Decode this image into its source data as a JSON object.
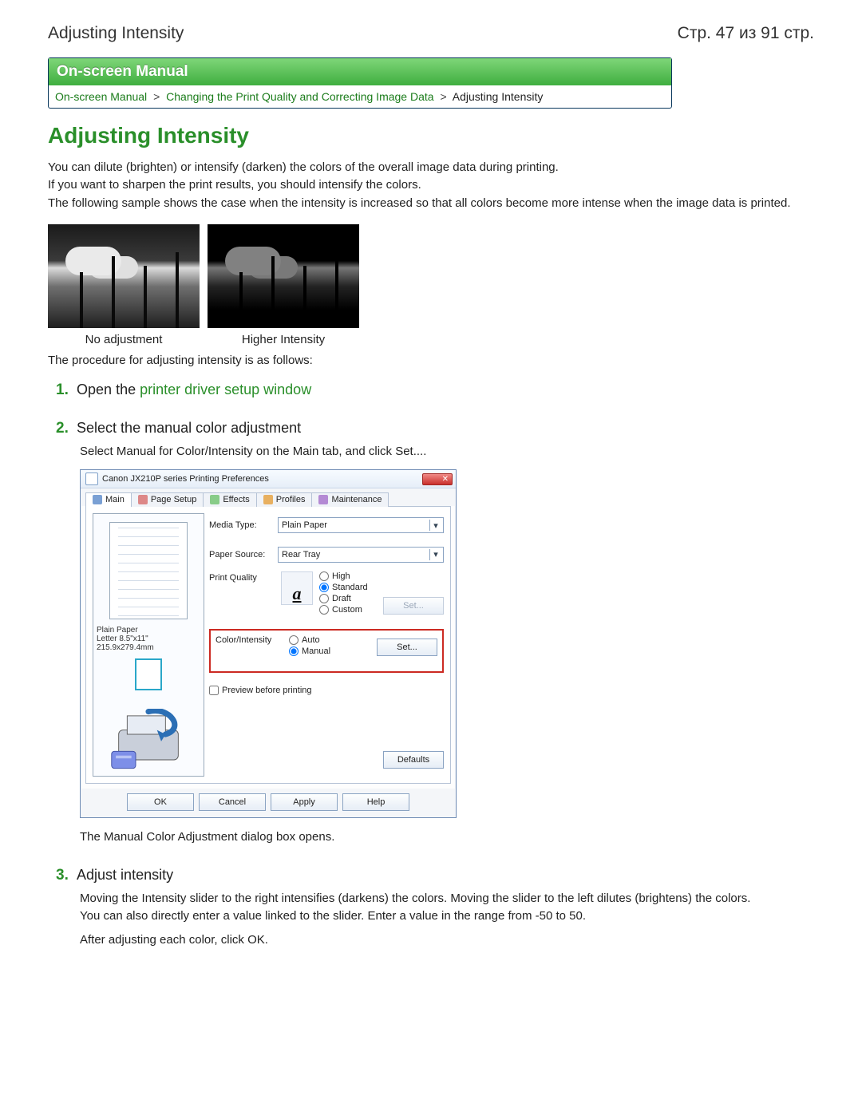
{
  "header": {
    "left": "Adjusting Intensity",
    "right": "Стр. 47 из 91 стр."
  },
  "banner": "On-screen Manual",
  "breadcrumb": {
    "a": "On-screen Manual",
    "b": "Changing the Print Quality and Correcting Image Data",
    "here": "Adjusting Intensity"
  },
  "title": "Adjusting Intensity",
  "intro": {
    "p1": "You can dilute (brighten) or intensify (darken) the colors of the overall image data during printing.",
    "p2": "If you want to sharpen the print results, you should intensify the colors.",
    "p3": "The following sample shows the case when the intensity is increased so that all colors become more intense when the image data is printed."
  },
  "samples": {
    "left": "No adjustment",
    "right": "Higher Intensity"
  },
  "procedure_line": "The procedure for adjusting intensity is as follows:",
  "steps": {
    "s1": {
      "pre": "Open the ",
      "link": "printer driver setup window"
    },
    "s2": {
      "title": "Select the manual color adjustment",
      "desc": "Select Manual for Color/Intensity on the Main tab, and click Set....",
      "after": "The Manual Color Adjustment dialog box opens."
    },
    "s3": {
      "title": "Adjust intensity",
      "p1": "Moving the Intensity slider to the right intensifies (darkens) the colors. Moving the slider to the left dilutes (brightens) the colors.",
      "p2": "You can also directly enter a value linked to the slider. Enter a value in the range from -50 to 50.",
      "p3": "After adjusting each color, click OK."
    }
  },
  "dialog": {
    "title": "Canon JX210P series Printing Preferences",
    "close_glyph": "✕",
    "tabs": {
      "main": "Main",
      "page": "Page Setup",
      "effects": "Effects",
      "profiles": "Profiles",
      "maint": "Maintenance"
    },
    "labels": {
      "media": "Media Type:",
      "source": "Paper Source:",
      "quality": "Print Quality",
      "color": "Color/Intensity",
      "preview_chk": "Preview before printing"
    },
    "values": {
      "media": "Plain Paper",
      "source": "Rear Tray"
    },
    "quality_opts": {
      "high": "High",
      "standard": "Standard",
      "draft": "Draft",
      "custom": "Custom"
    },
    "color_opts": {
      "auto": "Auto",
      "manual": "Manual"
    },
    "quality_icon": "a",
    "buttons": {
      "set": "Set...",
      "defaults": "Defaults",
      "ok": "OK",
      "cancel": "Cancel",
      "apply": "Apply",
      "help": "Help"
    },
    "preview_info": {
      "l1": "Plain Paper",
      "l2": "Letter 8.5\"x11\" 215.9x279.4mm"
    }
  }
}
